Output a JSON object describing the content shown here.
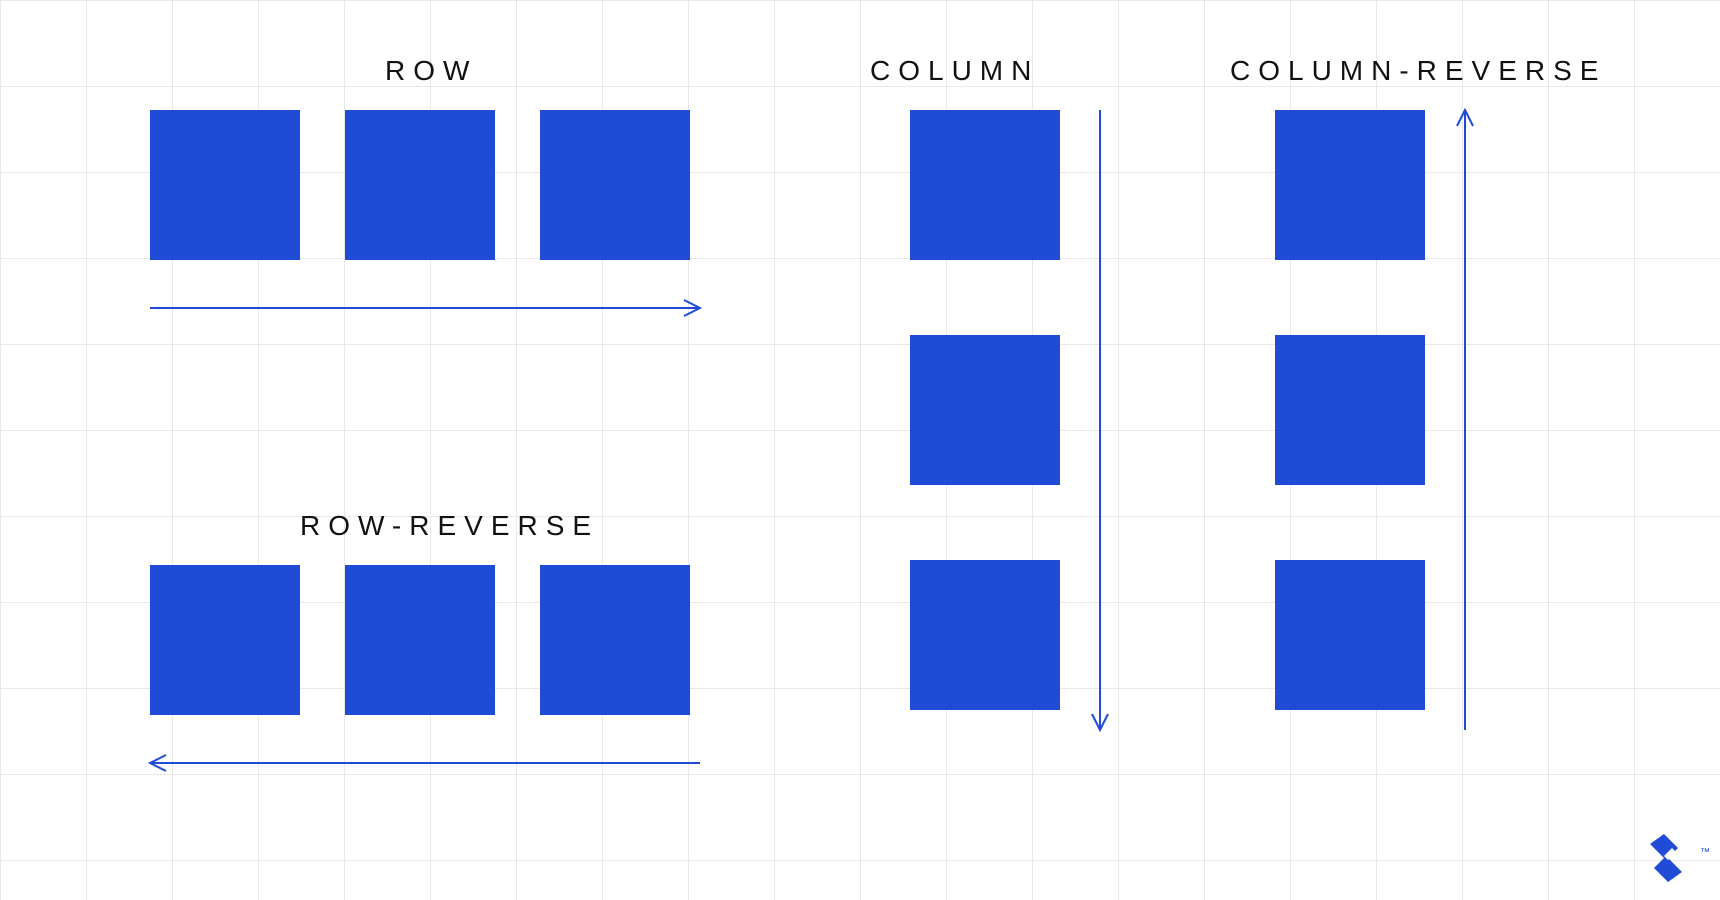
{
  "labels": {
    "row": "ROW",
    "row_reverse": "ROW-REVERSE",
    "column": "COLUMN",
    "column_reverse": "COLUMN-REVERSE"
  },
  "colors": {
    "box": "#1f4bd6",
    "arrow": "#1f4bd6",
    "grid": "#e8e8e8",
    "text": "#111111"
  },
  "diagram": {
    "groups": [
      {
        "name": "row",
        "orientation": "horizontal",
        "direction": "left-to-right",
        "boxes": 3
      },
      {
        "name": "row-reverse",
        "orientation": "horizontal",
        "direction": "right-to-left",
        "boxes": 3
      },
      {
        "name": "column",
        "orientation": "vertical",
        "direction": "top-to-bottom",
        "boxes": 3
      },
      {
        "name": "column-reverse",
        "orientation": "vertical",
        "direction": "bottom-to-top",
        "boxes": 3
      }
    ]
  },
  "logo": {
    "name": "toptal",
    "trademark": "™"
  }
}
